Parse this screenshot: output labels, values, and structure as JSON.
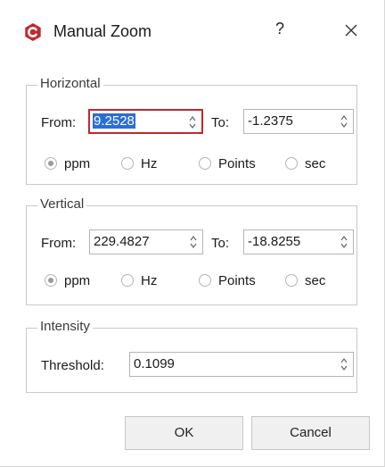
{
  "window": {
    "title": "Manual Zoom",
    "help_label": "?"
  },
  "horizontal": {
    "group_label": "Horizontal",
    "from_label": "From:",
    "from_value": "9.2528",
    "to_label": "To:",
    "to_value": "-1.2375",
    "units": [
      {
        "label": "ppm",
        "selected": true
      },
      {
        "label": "Hz",
        "selected": false
      },
      {
        "label": "Points",
        "selected": false
      },
      {
        "label": "sec",
        "selected": false
      }
    ]
  },
  "vertical": {
    "group_label": "Vertical",
    "from_label": "From:",
    "from_value": "229.4827",
    "to_label": "To:",
    "to_value": "-18.8255",
    "units": [
      {
        "label": "ppm",
        "selected": true
      },
      {
        "label": "Hz",
        "selected": false
      },
      {
        "label": "Points",
        "selected": false
      },
      {
        "label": "sec",
        "selected": false
      }
    ]
  },
  "intensity": {
    "group_label": "Intensity",
    "threshold_label": "Threshold:",
    "threshold_value": "0.1099"
  },
  "buttons": {
    "ok": "OK",
    "cancel": "Cancel"
  },
  "colors": {
    "brand_red": "#c0282d",
    "selection_blue": "#2a6fd6"
  },
  "icons": [
    "app-logo-icon",
    "help-icon",
    "close-icon",
    "spin-arrows-icon"
  ]
}
